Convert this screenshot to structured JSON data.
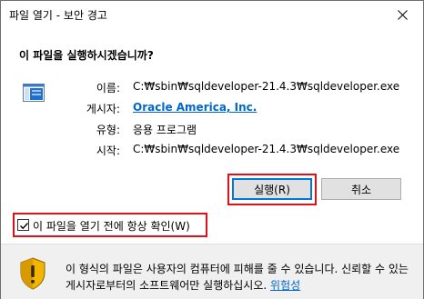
{
  "window": {
    "title": "파일 열기 - 보안 경고",
    "close_label": "×"
  },
  "question": "이 파일을 실행하시겠습니까?",
  "file_info": {
    "name_label": "이름:",
    "name_value": "C:₩sbin₩sqldeveloper-21.4.3₩sqldeveloper.exe",
    "publisher_label": "게시자:",
    "publisher_value": "Oracle America, Inc.",
    "type_label": "유형:",
    "type_value": "응용 프로그램",
    "from_label": "시작:",
    "from_value": "C:₩sbin₩sqldeveloper-21.4.3₩sqldeveloper.exe"
  },
  "buttons": {
    "run": "실행(R)",
    "cancel": "취소"
  },
  "checkbox": {
    "label": "이 파일을 열기 전에 항상 확인(W)",
    "checked": true
  },
  "warning": {
    "text": "이 형식의 파일은 사용자의 컴퓨터에 피해를 줄 수 있습니다. 신뢰할 수 있는 게시자로부터의 소프트웨어만 실행하십시오.",
    "link": "위험성"
  },
  "colors": {
    "highlight": "#e0101a",
    "link": "#0066cc",
    "shield_yellow": "#f2b500"
  },
  "icons": {
    "file": "application-window-icon",
    "shield": "security-shield-warning-icon",
    "close": "close-icon"
  }
}
